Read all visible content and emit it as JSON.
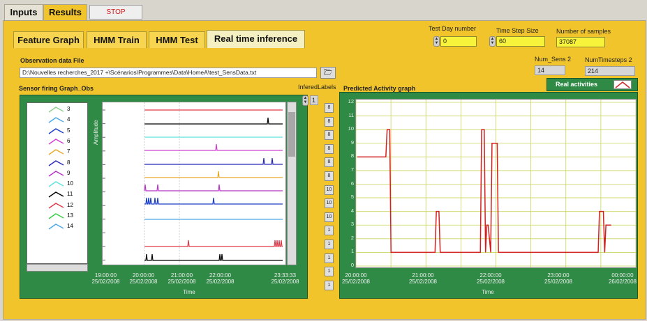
{
  "top_tabs": [
    "Inputs",
    "Results"
  ],
  "stop_label": "STOP",
  "sub_tabs": [
    "Feature Graph",
    "HMM Train",
    "HMM Test",
    "Real time inference"
  ],
  "controls": {
    "test_day": {
      "label": "Test Day number",
      "value": "0"
    },
    "time_step": {
      "label": "Time Step Size",
      "value": "60"
    },
    "num_samples": {
      "label": "Number of samples",
      "value": "37087"
    },
    "num_sens": {
      "label": "Num_Sens 2",
      "value": "14"
    },
    "num_timesteps": {
      "label": "NumTimesteps 2",
      "value": "214"
    }
  },
  "observation": {
    "label": "Observation data File",
    "path": "D:\\Nouvelles recherches_2017 +\\Scénarios\\Programmes\\Data\\HomeA\\test_SensData.txt"
  },
  "sensor_graph": {
    "title": "Sensor firing Graph_Obs",
    "ylabel": "Amplitude",
    "xlabel": "Time",
    "x_ticks": [
      {
        "time": "19:00:00",
        "date": "25/02/2008"
      },
      {
        "time": "20:00:00",
        "date": "25/02/2008"
      },
      {
        "time": "21:00:00",
        "date": "25/02/2008"
      },
      {
        "time": "22:00:00",
        "date": "25/02/2008"
      },
      {
        "time": "23:33:33",
        "date": "25/02/2008"
      }
    ],
    "legend": [
      {
        "n": "3",
        "color": "#8fd08f"
      },
      {
        "n": "4",
        "color": "#4aa8e8"
      },
      {
        "n": "5",
        "color": "#1a3cc8"
      },
      {
        "n": "6",
        "color": "#d040d0"
      },
      {
        "n": "7",
        "color": "#e8a828"
      },
      {
        "n": "8",
        "color": "#2828b8"
      },
      {
        "n": "9",
        "color": "#b830c8"
      },
      {
        "n": "10",
        "color": "#60e0e0"
      },
      {
        "n": "11",
        "color": "#000000"
      },
      {
        "n": "12",
        "color": "#e03848"
      },
      {
        "n": "13",
        "color": "#30d040"
      },
      {
        "n": "14",
        "color": "#4aa8e8"
      }
    ]
  },
  "infered": {
    "label": "InferedLabels",
    "index": "1",
    "values": [
      "8",
      "8",
      "8",
      "8",
      "8",
      "8",
      "10",
      "10",
      "10",
      "1",
      "1",
      "1",
      "1",
      "1"
    ]
  },
  "chart_data": {
    "type": "line",
    "title": "Predicted Activity graph",
    "xlabel": "Time",
    "ylabel": "",
    "ylim": [
      0,
      12
    ],
    "y_ticks": [
      "0",
      "1",
      "2",
      "3",
      "4",
      "5",
      "6",
      "7",
      "8",
      "9",
      "10",
      "11",
      "12"
    ],
    "x_ticks": [
      {
        "time": "20:00:00",
        "date": "25/02/2008"
      },
      {
        "time": "21:00:00",
        "date": "25/02/2008"
      },
      {
        "time": "22:00:00",
        "date": "25/02/2008"
      },
      {
        "time": "23:00:00",
        "date": "25/02/2008"
      },
      {
        "time": "00:00:00",
        "date": "26/02/2008"
      }
    ],
    "legend": "Real activities",
    "series": [
      {
        "name": "Real activities",
        "color": "#d42020",
        "x": [
          0,
          22,
          23,
          25,
          26,
          35,
          60,
          61,
          63,
          64,
          95,
          96,
          98,
          99,
          100,
          101,
          103,
          104,
          108,
          109,
          110,
          111,
          112,
          112.5,
          113,
          114,
          116,
          117,
          118,
          123,
          124,
          186,
          187,
          190,
          191,
          192,
          196
        ],
        "y": [
          8,
          8,
          10,
          10,
          1,
          1,
          1,
          4,
          4,
          1,
          1,
          10,
          10,
          1,
          3,
          3,
          1,
          9,
          9,
          1,
          1,
          1,
          1,
          1,
          1,
          1,
          1,
          1,
          1,
          1,
          1,
          1,
          4,
          4,
          1,
          3,
          3
        ]
      }
    ],
    "xlim": [
      0,
      214
    ]
  }
}
